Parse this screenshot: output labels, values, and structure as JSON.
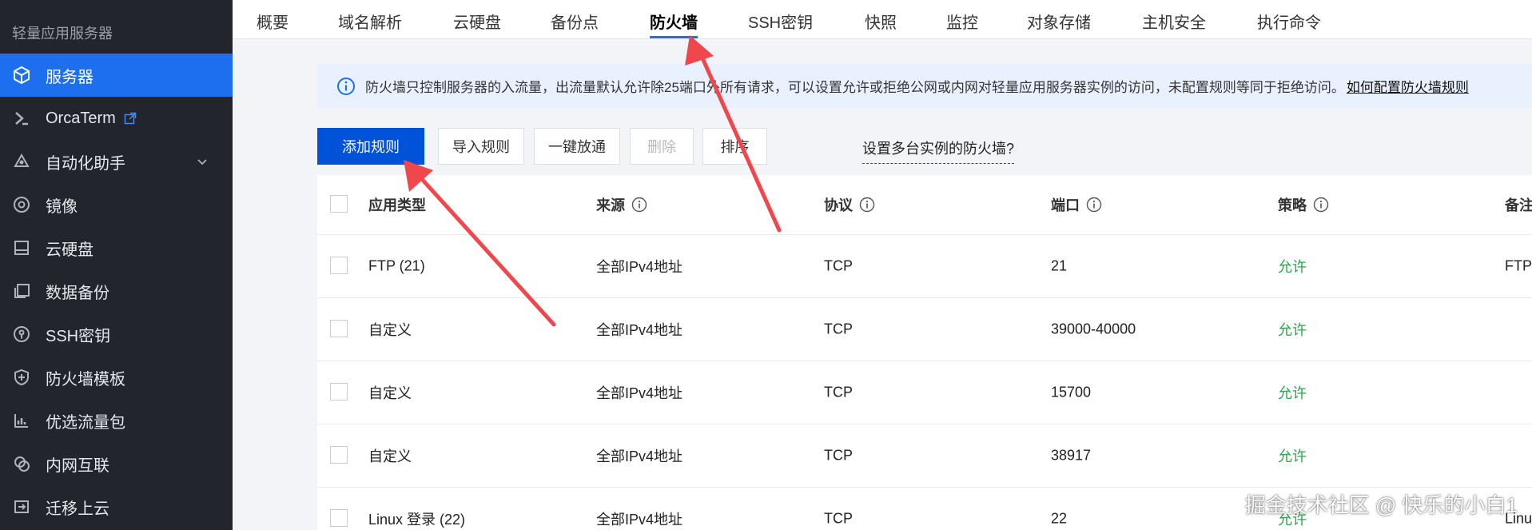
{
  "sidebar": {
    "title": "轻量应用服务器",
    "items": [
      {
        "label": "服务器",
        "icon": "cube-icon",
        "active": true
      },
      {
        "label": "OrcaTerm",
        "icon": "terminal-icon"
      },
      {
        "label": "自动化助手",
        "icon": "automation-icon"
      },
      {
        "label": "镜像",
        "icon": "disc-icon"
      },
      {
        "label": "云硬盘",
        "icon": "disk-icon"
      },
      {
        "label": "数据备份",
        "icon": "backup-icon"
      },
      {
        "label": "SSH密钥",
        "icon": "key-icon"
      },
      {
        "label": "防火墙模板",
        "icon": "shield-icon"
      },
      {
        "label": "优选流量包",
        "icon": "traffic-icon"
      },
      {
        "label": "内网互联",
        "icon": "network-icon"
      },
      {
        "label": "迁移上云",
        "icon": "migrate-icon"
      }
    ]
  },
  "tabs": [
    "概要",
    "域名解析",
    "云硬盘",
    "备份点",
    "防火墙",
    "SSH密钥",
    "快照",
    "监控",
    "对象存储",
    "主机安全",
    "执行命令"
  ],
  "active_tab": "防火墙",
  "notice": {
    "text": "防火墙只控制服务器的入流量，出流量默认允许除25端口外所有请求，可以设置允许或拒绝公网或内网对轻量应用服务器实例的访问，未配置规则等同于拒绝访问。",
    "link": "如何配置防火墙规则"
  },
  "toolbar": {
    "add": "添加规则",
    "import": "导入规则",
    "open_all": "一键放通",
    "delete": "删除",
    "sort": "排序",
    "multi_link": "设置多台实例的防火墙?"
  },
  "table": {
    "headers": [
      "应用类型",
      "来源",
      "协议",
      "端口",
      "策略",
      "备注"
    ],
    "rows": [
      [
        "FTP (21)",
        "全部IPv4地址",
        "TCP",
        "21",
        "允许",
        "FTP"
      ],
      [
        "自定义",
        "全部IPv4地址",
        "TCP",
        "39000-40000",
        "允许",
        ""
      ],
      [
        "自定义",
        "全部IPv4地址",
        "TCP",
        "15700",
        "允许",
        ""
      ],
      [
        "自定义",
        "全部IPv4地址",
        "TCP",
        "38917",
        "允许",
        ""
      ],
      [
        "Linux 登录 (22)",
        "全部IPv4地址",
        "TCP",
        "22",
        "允许",
        "Linu"
      ]
    ]
  },
  "watermark": "掘金技术社区 @ 快乐的小白1",
  "colors": {
    "accent": "#1e6ff0",
    "primary_button": "#0052d9",
    "allow": "#29a84a",
    "arrow": "#f0474d",
    "sidebar": "#22252b"
  }
}
